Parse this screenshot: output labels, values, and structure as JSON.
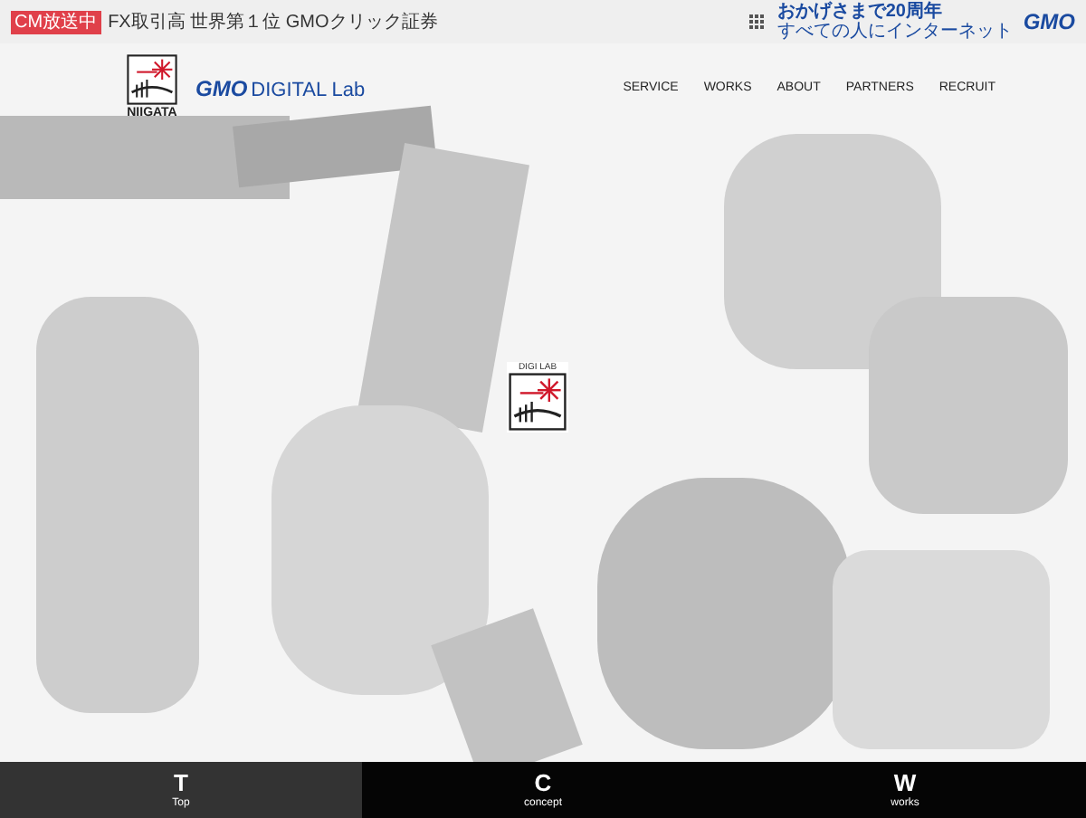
{
  "top_bar": {
    "badge": "CM放送中",
    "ad_text": "FX取引高 世界第１位 GMOクリック証券",
    "anniversary": "おかげさまで20周年",
    "tagline": "すべての人にインターネット",
    "brand": "GMO"
  },
  "header": {
    "logo_caption": "NIIGATA",
    "brand_bold": "GMO",
    "brand_light": "DIGITAL Lab",
    "nav": [
      {
        "label": "SERVICE"
      },
      {
        "label": "WORKS"
      },
      {
        "label": "ABOUT"
      },
      {
        "label": "PARTNERS"
      },
      {
        "label": "RECRUIT"
      }
    ]
  },
  "hero": {
    "emblem_text": "DIGI LAB"
  },
  "bottom_tabs": [
    {
      "letter": "T",
      "label": "Top",
      "selected": true
    },
    {
      "letter": "C",
      "label": "concept",
      "selected": false
    },
    {
      "letter": "W",
      "label": "works",
      "selected": false
    }
  ]
}
